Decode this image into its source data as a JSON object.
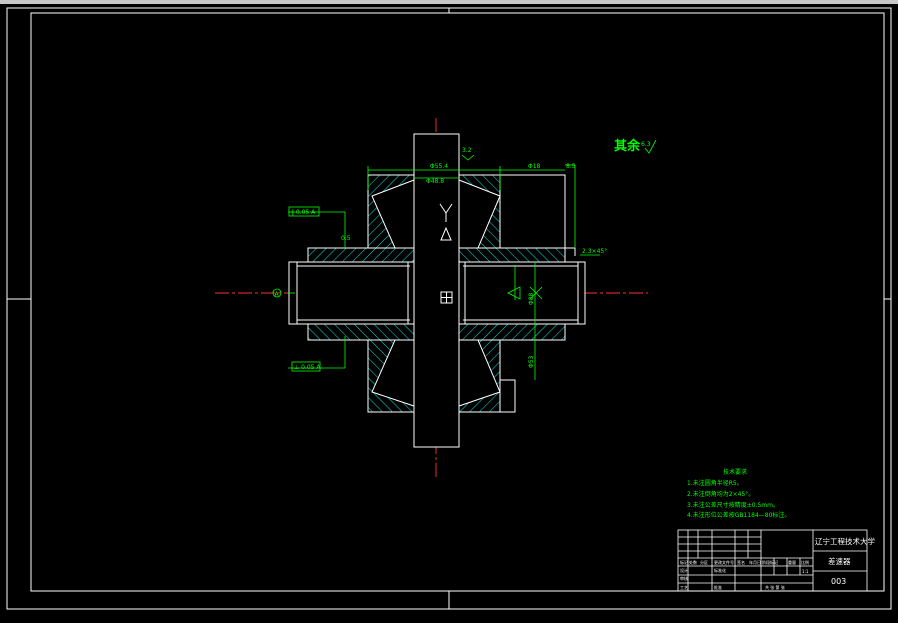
{
  "surface_note": {
    "text": "其余",
    "symbol": "6.3"
  },
  "datum_frames": {
    "top": "∥ 0.05 A",
    "bottom": "⊥ 0.05 A"
  },
  "dimensions": {
    "upper_width": "Φ55.4",
    "inner_width": "Φ48.8",
    "right_top_a": "Φ18",
    "right_top_b": "8.5",
    "right_chamfer": "2.3×45°",
    "right_vertical": "Φ88",
    "right_lower": "Φ53",
    "left_small": "0.5",
    "datum_label": "A",
    "roughness_top": "3.2"
  },
  "tech_requirements": {
    "title": "技术要求",
    "items": [
      "1.未注圆角半径R5。",
      "2.未注倒角均为2×45°。",
      "3.未注公差尺寸按精度±0.5mm。",
      "4.未注形位公差按GB1184—80标注。"
    ]
  },
  "title_block": {
    "school": "辽宁工程技术大学",
    "part_name": "差速器",
    "drawing_no": "003",
    "labels": {
      "mark": "标记",
      "count": "处数",
      "zone": "分区",
      "change_no": "更改文件号",
      "sign": "签名",
      "date": "年月日",
      "designer": "设计",
      "standard": "标准化",
      "stage_mark": "阶段标记",
      "weight": "重量",
      "scale": "比例",
      "scale_value": "1:1",
      "check": "审核",
      "process": "工艺",
      "approve": "批准",
      "sheets": "共  张  第  张"
    }
  }
}
